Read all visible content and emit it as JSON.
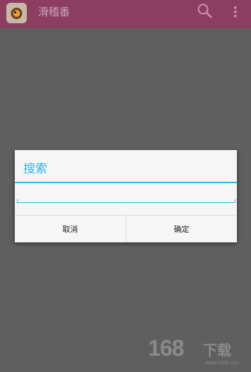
{
  "app": {
    "title": "滑稽番",
    "icon": "app-logo-icon",
    "search_icon": "search-icon",
    "overflow_icon": "overflow-menu-icon"
  },
  "dialog": {
    "title": "搜索",
    "input_value": "",
    "cancel_label": "取消",
    "confirm_label": "确定"
  },
  "watermark": {
    "number": "168",
    "text": "下载",
    "url": "www.it168.com"
  },
  "colors": {
    "accent": "#33b5e5",
    "actionbar": "#8c3e5f",
    "overlay": "#5f5f5f",
    "dialog_bg": "#f6f6f6"
  }
}
